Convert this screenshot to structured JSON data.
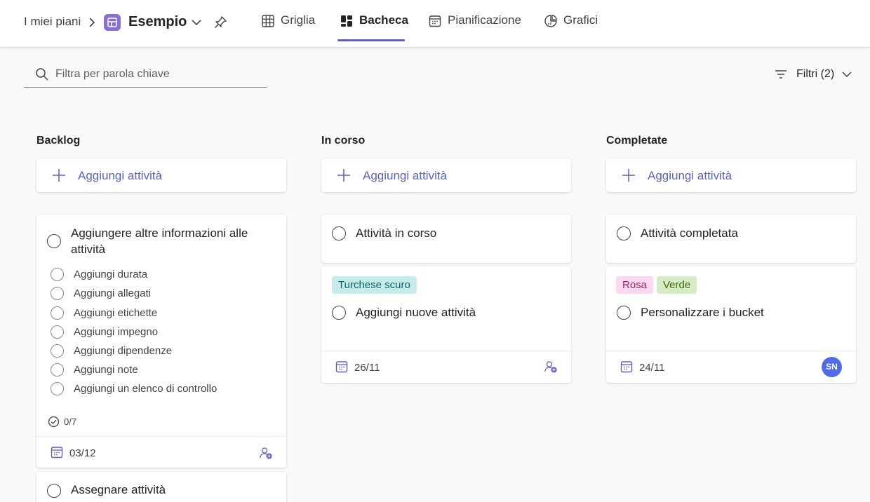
{
  "header": {
    "breadcrumb": "I miei piani",
    "plan_title": "Esempio",
    "tabs": [
      {
        "label": "Griglia",
        "icon": "grid-icon"
      },
      {
        "label": "Bacheca",
        "icon": "board-icon",
        "active": true
      },
      {
        "label": "Pianificazione",
        "icon": "calendar-icon"
      },
      {
        "label": "Grafici",
        "icon": "chart-icon"
      }
    ]
  },
  "search": {
    "placeholder": "Filtra per parola chiave"
  },
  "filters": {
    "label": "Filtri (2)"
  },
  "accent_color": "#5b5fc7",
  "columns": [
    {
      "title": "Backlog",
      "add_label": "Aggiungi attività",
      "cards": [
        {
          "title": "Aggiungere altre informazioni alle attività",
          "checklist": [
            "Aggiungi durata",
            "Aggiungi allegati",
            "Aggiungi etichette",
            "Aggiungi impegno",
            "Aggiungi dipendenze",
            "Aggiungi note",
            "Aggiungi un elenco di controllo"
          ],
          "progress": "0/7",
          "due": "03/12"
        },
        {
          "title": "Assegnare attività"
        }
      ]
    },
    {
      "title": "In corso",
      "add_label": "Aggiungi attività",
      "cards": [
        {
          "title": "Attività in corso"
        },
        {
          "tags": [
            {
              "label": "Turchese scuro",
              "bg": "#c7ebe9",
              "fg": "#00666d"
            }
          ],
          "title": "Aggiungi nuove attività",
          "due": "26/11"
        }
      ]
    },
    {
      "title": "Completate",
      "add_label": "Aggiungi attività",
      "cards": [
        {
          "title": "Attività completata"
        },
        {
          "tags": [
            {
              "label": "Rosa",
              "bg": "#fbd9ee",
              "fg": "#9b1f6b"
            },
            {
              "label": "Verde",
              "bg": "#d7ebc5",
              "fg": "#3b6a12"
            }
          ],
          "title": "Personalizzare i bucket",
          "due": "24/11",
          "assignee": "SN"
        }
      ]
    }
  ]
}
